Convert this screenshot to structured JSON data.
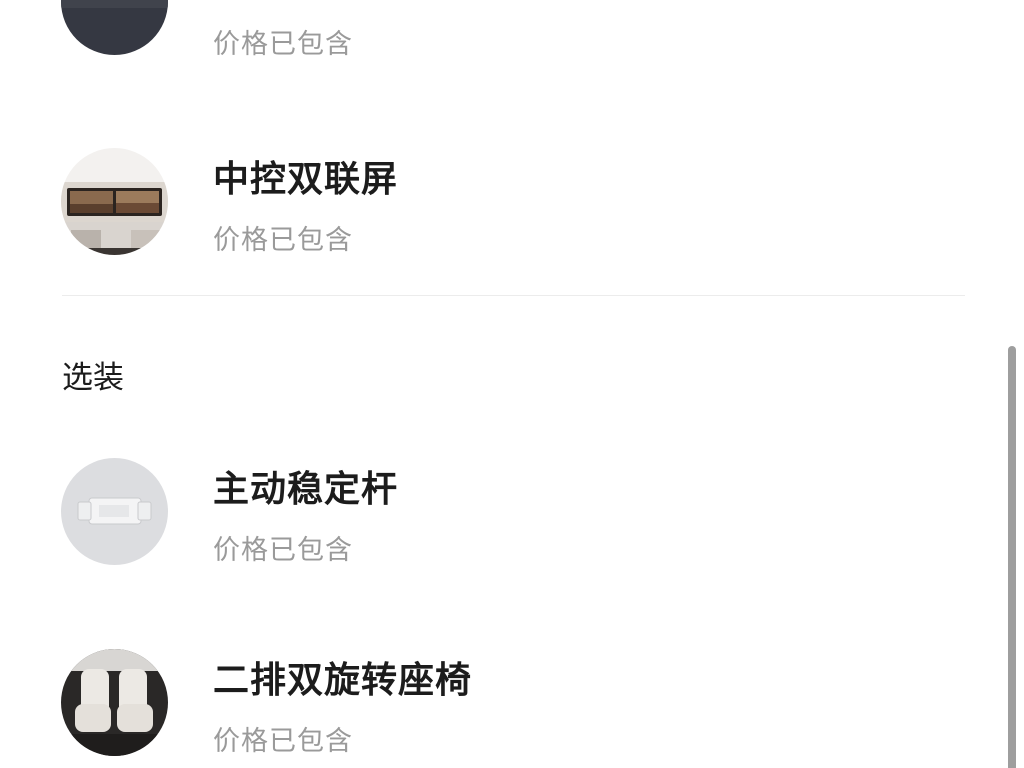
{
  "options": {
    "included": [
      {
        "name": "",
        "subtitle": "价格已包含",
        "icon": "wheel-thumbnail"
      },
      {
        "name": "中控双联屏",
        "subtitle": "价格已包含",
        "icon": "dual-screen-thumbnail"
      }
    ],
    "optional_section_title": "选装",
    "optional": [
      {
        "name": "主动稳定杆",
        "subtitle": "价格已包含",
        "icon": "stabilizer-bar-thumbnail"
      },
      {
        "name": "二排双旋转座椅",
        "subtitle": "价格已包含",
        "icon": "swivel-seat-thumbnail"
      }
    ]
  },
  "colors": {
    "title": "#1c1c1c",
    "subtitle": "#9a9a9a",
    "divider": "#ececec",
    "scrollbar": "#9e9e9e"
  }
}
